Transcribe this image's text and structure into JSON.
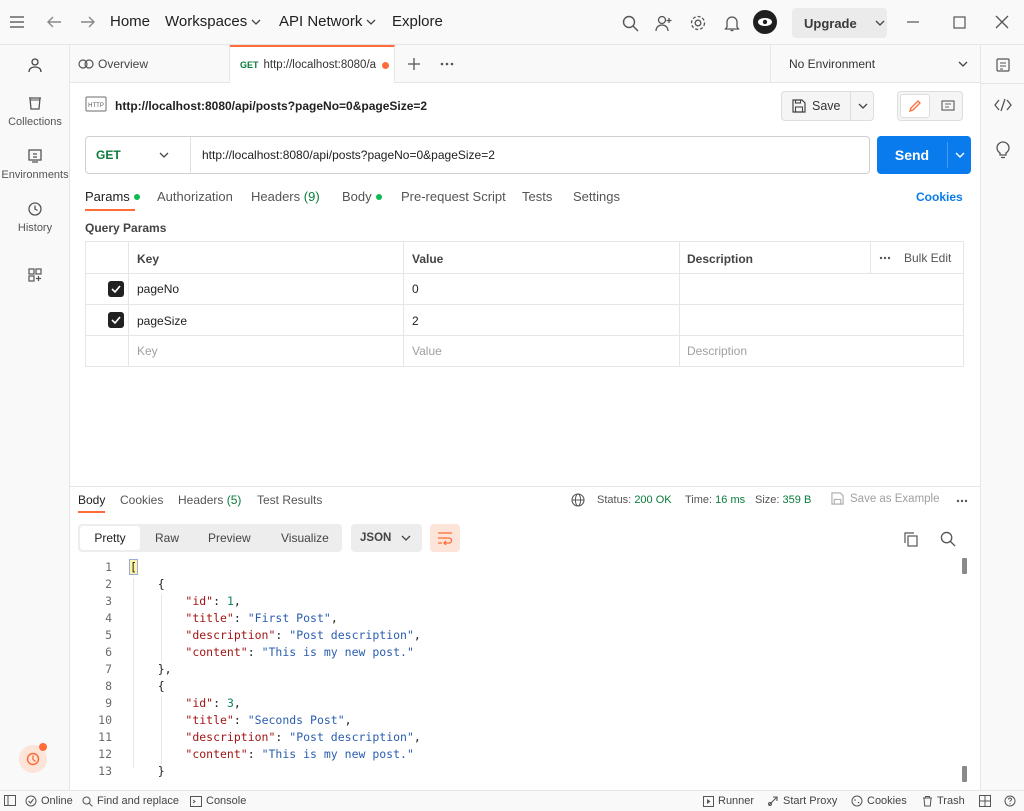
{
  "topbar": {
    "home": "Home",
    "workspaces": "Workspaces",
    "api_network": "API Network",
    "explore": "Explore",
    "upgrade": "Upgrade"
  },
  "sidebar": {
    "items": [
      {
        "label": "",
        "icon": "user-icon"
      },
      {
        "label": "Collections",
        "icon": "collections-icon"
      },
      {
        "label": "Environments",
        "icon": "environments-icon"
      },
      {
        "label": "History",
        "icon": "history-icon"
      },
      {
        "label": "",
        "icon": "add-widgets-icon"
      }
    ]
  },
  "tabs": {
    "overview": "Overview",
    "active_method": "GET",
    "active_url": "http://localhost:8080/a",
    "environment": "No Environment"
  },
  "request": {
    "title": "http://localhost:8080/api/posts?pageNo=0&pageSize=2",
    "save": "Save",
    "method": "GET",
    "url": "http://localhost:8080/api/posts?pageNo=0&pageSize=2",
    "send": "Send",
    "tabs": {
      "params": "Params",
      "authorization": "Authorization",
      "headers": "Headers",
      "headers_count": "(9)",
      "body": "Body",
      "prerequest": "Pre-request Script",
      "tests": "Tests",
      "settings": "Settings",
      "cookies": "Cookies"
    },
    "query_params_label": "Query Params",
    "table": {
      "col_key": "Key",
      "col_value": "Value",
      "col_description": "Description",
      "bulk_edit": "Bulk Edit",
      "rows": [
        {
          "key": "pageNo",
          "value": "0",
          "description": "",
          "checked": true
        },
        {
          "key": "pageSize",
          "value": "2",
          "description": "",
          "checked": true
        }
      ],
      "placeholder": {
        "key": "Key",
        "value": "Value",
        "description": "Description"
      }
    }
  },
  "response": {
    "tabs": {
      "body": "Body",
      "cookies": "Cookies",
      "headers": "Headers",
      "headers_count": "(5)",
      "test_results": "Test Results"
    },
    "status_label": "Status:",
    "status_value": "200 OK",
    "time_label": "Time:",
    "time_value": "16 ms",
    "size_label": "Size:",
    "size_value": "359 B",
    "save_example": "Save as Example",
    "formats": {
      "pretty": "Pretty",
      "raw": "Raw",
      "preview": "Preview",
      "visualize": "Visualize",
      "type": "JSON"
    },
    "line_numbers": [
      "1",
      "2",
      "3",
      "4",
      "5",
      "6",
      "7",
      "8",
      "9",
      "10",
      "11",
      "12",
      "13"
    ]
  },
  "statusbar": {
    "online": "Online",
    "find_replace": "Find and replace",
    "console": "Console",
    "runner": "Runner",
    "start_proxy": "Start Proxy",
    "cookies": "Cookies",
    "trash": "Trash"
  },
  "colors": {
    "accent": "#ff6c37",
    "send": "#097bed",
    "status_ok": "#0cbb52"
  }
}
